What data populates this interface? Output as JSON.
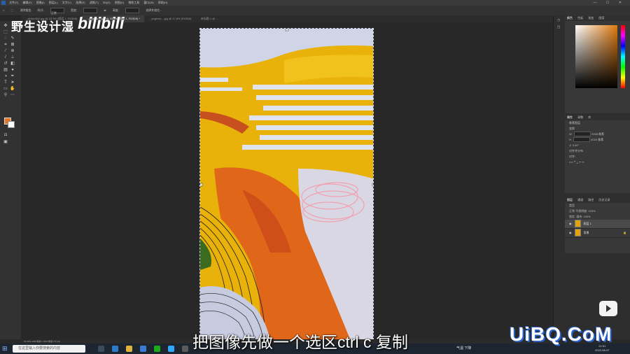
{
  "menubar": {
    "items": [
      "文件(F)",
      "编辑(E)",
      "图像(I)",
      "图层(L)",
      "文字(Y)",
      "选择(S)",
      "滤镜(T)",
      "3D(D)",
      "视图(V)",
      "增效工具",
      "窗口(W)",
      "帮助(H)"
    ],
    "window_controls": "— ☐ ✕"
  },
  "options": {
    "antialias_label": "消除锯齿",
    "style_label": "样式:",
    "style_value": "正常",
    "width_label": "宽度:",
    "height_label": "高度:",
    "select_mask_button": "选择并遮住..."
  },
  "tabs": [
    {
      "label": "...ab4ec9b2.jpg @ 33.3% (图层 1, RGB/8)",
      "active": false
    },
    {
      "label": "...pngtree-...jpg @ 33.3% (图层 1, RGB/8) *",
      "active": true
    },
    {
      "label": "...pngtree-...jpg @ 17.8% (RGB/8)",
      "active": false
    },
    {
      "label": "未标题-1 @ ...",
      "active": false
    }
  ],
  "watermark": {
    "channel": "野生设计湿",
    "site": "bilibili"
  },
  "panels": {
    "color_tabs": [
      "颜色",
      "色板",
      "渐变",
      "图案"
    ],
    "props_tabs": [
      "属性",
      "调整",
      "库"
    ],
    "doc_label": "像素图层",
    "transform_label": "变换",
    "w_label": "W",
    "w_value": "2268 像素",
    "h_label": "H",
    "h_value": "4020 像素",
    "x_label": "X",
    "x_value": "0 像素",
    "y_label": "Y",
    "y_value": "0 像素",
    "angle_value": "0.00°",
    "align_label": "对齐并分布",
    "align_sub": "对齐:",
    "layer_tabs": [
      "图层",
      "通道",
      "路径",
      "历史记录"
    ],
    "kind_label": "类型",
    "mode_label": "正常",
    "opacity_label": "不透明度:",
    "opacity_value": "100%",
    "lock_label": "锁定:",
    "fill_label": "填充:",
    "fill_value": "100%",
    "layers": [
      {
        "name": "图层 1",
        "selected": true
      },
      {
        "name": "背景",
        "selected": false
      }
    ]
  },
  "status": {
    "zoom": "33.33%",
    "info": "2268 像素 x 4020 像素 (72 ppi)"
  },
  "taskbar": {
    "search_placeholder": "在这里输入你要搜索的内容",
    "weather": "气温 下降",
    "time": "21:51",
    "date": "2022-06-07"
  },
  "subtitle": "把图像先做一个选区ctrl c 复制",
  "uibq_logo": "UiBQ.CoM",
  "colors": {
    "foreground": "#e8741f",
    "background": "#ffffff",
    "yellow": "#e8b20a",
    "orange": "#e0671a",
    "sky": "#cdd3e6"
  }
}
